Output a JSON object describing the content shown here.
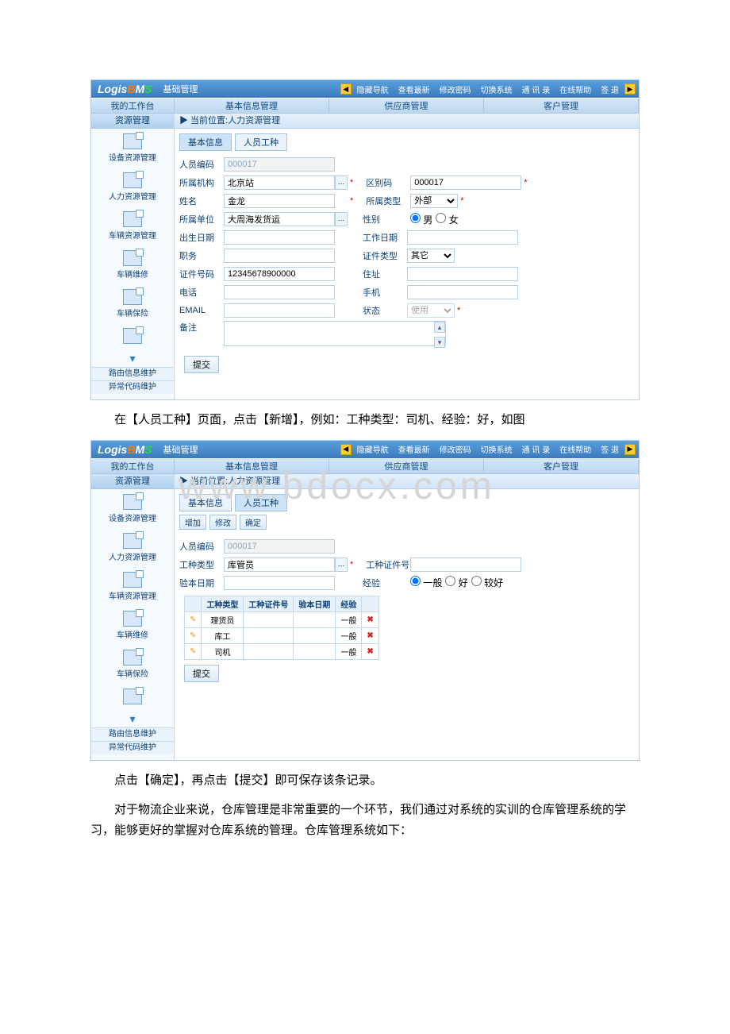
{
  "topbar": {
    "logo_prefix": "Logis",
    "logo_b": "B",
    "logo_m": "M",
    "logo_s": "S",
    "title": "基础管理",
    "buttons": [
      "隐藏导航",
      "查看最新",
      "修改密码",
      "切换系统",
      "通 讯 录",
      "在线帮助",
      "签  退"
    ]
  },
  "tabs": [
    "我的工作台",
    "基本信息管理",
    "供应商管理",
    "客户管理"
  ],
  "sidebar": {
    "head": "资源管理",
    "items": [
      "设备资源管理",
      "人力资源管理",
      "车辆资源管理",
      "车辆维修",
      "车辆保险"
    ],
    "links": [
      "路由信息维护",
      "异常代码维护"
    ]
  },
  "breadcrumb_prefix": "▶ 当前位置:",
  "breadcrumb": "人力资源管理",
  "screen1": {
    "subtabs": [
      "基本信息",
      "人员工种"
    ],
    "labels": {
      "person_code": "人员编码",
      "org": "所属机构",
      "area_code": "区别码",
      "name": "姓名",
      "belong_type": "所属类型",
      "unit": "所属单位",
      "gender": "性别",
      "birth": "出生日期",
      "work_date": "工作日期",
      "position": "职务",
      "cert_type": "证件类型",
      "cert_no": "证件号码",
      "address": "住址",
      "phone": "电话",
      "mobile": "手机",
      "email": "EMAIL",
      "status": "状态",
      "remark": "备注"
    },
    "values": {
      "person_code": "000017",
      "org": "北京站",
      "area_code": "000017",
      "name": "金龙",
      "belong_type": "外部",
      "unit": "大周海发货运",
      "gender_male": "男",
      "gender_female": "女",
      "cert_type": "其它",
      "cert_no": "12345678900000",
      "status": "使用"
    },
    "submit": "提交"
  },
  "text1a": "在【人员工种】页面，点击【新增】，例如：工种类型：司机、经验：好，如图",
  "watermark": "www.bdocx.com",
  "screen2": {
    "subtabs": [
      "基本信息",
      "人员工种"
    ],
    "action_buttons": [
      "增加",
      "修改",
      "确定"
    ],
    "labels": {
      "person_code": "人员编码",
      "job_type": "工种类型",
      "job_cert": "工种证件号",
      "check_date": "验本日期",
      "exp": "经验"
    },
    "values": {
      "person_code": "000017",
      "job_type": "库管员",
      "exp_options": [
        "一般",
        "好",
        "较好"
      ]
    },
    "grid": {
      "headers": [
        "",
        "工种类型",
        "工种证件号",
        "验本日期",
        "经验",
        ""
      ],
      "rows": [
        {
          "type": "理货员",
          "exp": "一般"
        },
        {
          "type": "库工",
          "exp": "一般"
        },
        {
          "type": "司机",
          "exp": "一般"
        }
      ]
    },
    "submit": "提交"
  },
  "text2": "点击【确定】，再点击【提交】即可保存该条记录。",
  "text3": "对于物流企业来说，仓库管理是非常重要的一个环节，我们通过对系统的实训的仓库管理系统的学习，能够更好的掌握对仓库系统的管理。仓库管理系统如下："
}
